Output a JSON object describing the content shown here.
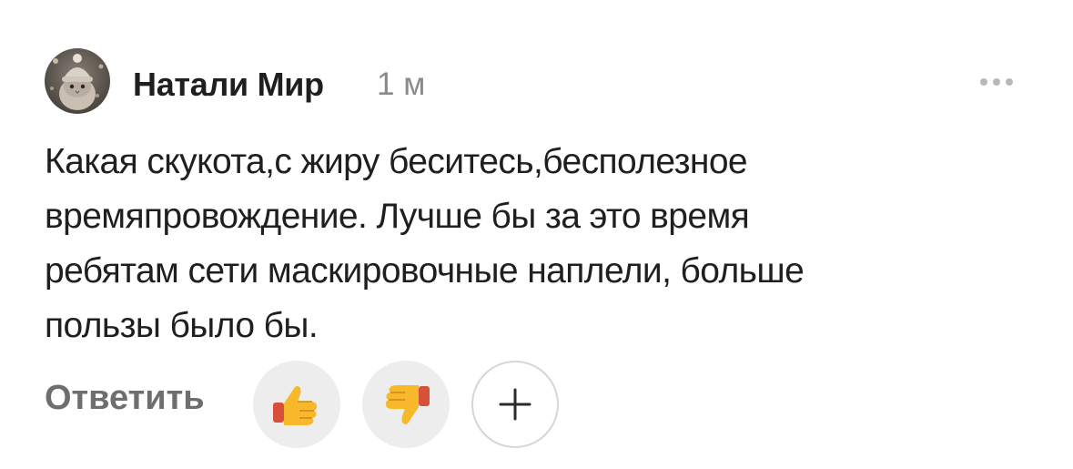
{
  "comment": {
    "author": "Натали Мир",
    "time": "1 м",
    "avatar_icon": "avatar-knitted-hat-cat",
    "text_lines": [
      "Какая скукота,с жиру беситесь,бесполезное",
      "времяпровождение. Лучше бы за это время",
      "ребятам сети маскировочные наплели, больше",
      "пользы было бы."
    ]
  },
  "actions": {
    "reply_label": "Ответить",
    "reactions": [
      {
        "icon": "thumbs-up-icon",
        "glyph": "👍"
      },
      {
        "icon": "thumbs-down-icon",
        "glyph": "👎"
      }
    ],
    "add_reaction_icon": "plus-icon",
    "more_icon": "more-dots-icon"
  }
}
